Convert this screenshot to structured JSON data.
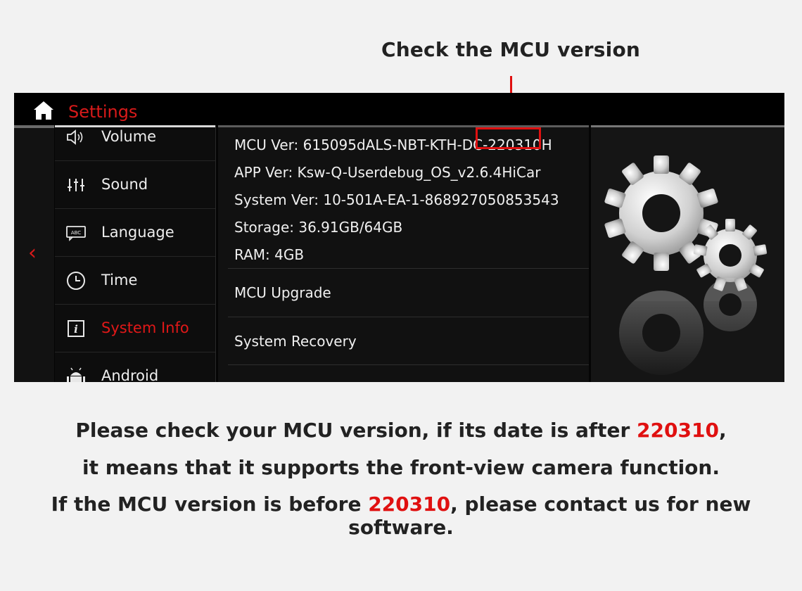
{
  "annotation": {
    "heading": "Check the MCU version"
  },
  "app": {
    "title": "Settings"
  },
  "menu": {
    "items": [
      {
        "label": "Volume",
        "icon": "speaker-icon",
        "active": false
      },
      {
        "label": "Sound",
        "icon": "equalizer-icon",
        "active": false
      },
      {
        "label": "Language",
        "icon": "keyboard-icon",
        "active": false
      },
      {
        "label": "Time",
        "icon": "clock-icon",
        "active": false
      },
      {
        "label": "System Info",
        "icon": "info-icon",
        "active": true
      },
      {
        "label": "Android",
        "icon": "android-icon",
        "active": false
      }
    ]
  },
  "info": {
    "mcu_ver": "MCU Ver: 615095dALS-NBT-KTH-DC-220310H",
    "app_ver": "APP Ver: Ksw-Q-Userdebug_OS_v2.6.4HiCar",
    "system_ver": "System Ver: 10-501A-EA-1-868927050853543",
    "storage": "Storage: 36.91GB/64GB",
    "ram": "RAM: 4GB"
  },
  "options": {
    "mcu_upgrade": "MCU Upgrade",
    "system_recovery": "System Recovery"
  },
  "caption": {
    "line1_a": "Please check your MCU version, if its date is after ",
    "line1_date": "220310",
    "line1_b": ",",
    "line2": "it means that it supports the front-view camera function.",
    "line3_a": "If the MCU version is before ",
    "line3_date": "220310",
    "line3_b": ", please contact us for new software."
  },
  "colors": {
    "accent": "#e01010",
    "background": "#f2f2f2",
    "screen": "#050505"
  }
}
